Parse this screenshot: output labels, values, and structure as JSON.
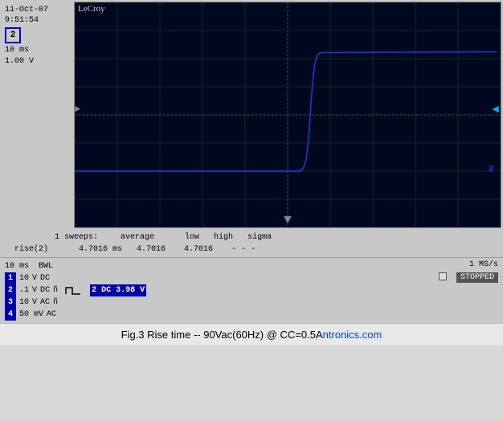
{
  "header": {
    "date": "11-Oct-07",
    "time": "9:51:54",
    "brand": "LeCroy",
    "channel_box": "2",
    "timebase": "10 ms",
    "voltage": "1.00 V"
  },
  "measurements": {
    "sweeps_label": "1 sweeps:",
    "col_average": "average",
    "col_low": "low",
    "col_high": "high",
    "col_sigma": "sigma",
    "param_label": "rise(2)",
    "value_average": "4.7016 ms",
    "value_low": "4.7016",
    "value_high": "4.7016",
    "value_sigma": "- - -"
  },
  "status_bar": {
    "timebase": "10 ms",
    "bwl": "BWL",
    "ch1_label": "1",
    "ch1_voltage": "10",
    "ch1_unit": "V",
    "ch1_coupling": "DC",
    "ch2_label": "2",
    "ch2_voltage": ".1",
    "ch2_unit": "V",
    "ch2_coupling": "DC",
    "ch2_extra": "ñ",
    "ch3_label": "3",
    "ch3_voltage": "10",
    "ch3_unit": "V",
    "ch3_coupling": "AC",
    "ch3_extra": "ñ",
    "ch4_label": "4",
    "ch4_voltage": "50 mV",
    "ch4_coupling": "AC",
    "sample_rate": "1 MS/s",
    "ch2_dc_val": "2 DC 3.98 V",
    "status": "STOPPED"
  },
  "caption": {
    "text": "Fig.3  Rise time  --  90Vac(60Hz) @  CC=0.5A",
    "blue_suffix": "ntronics.com"
  }
}
